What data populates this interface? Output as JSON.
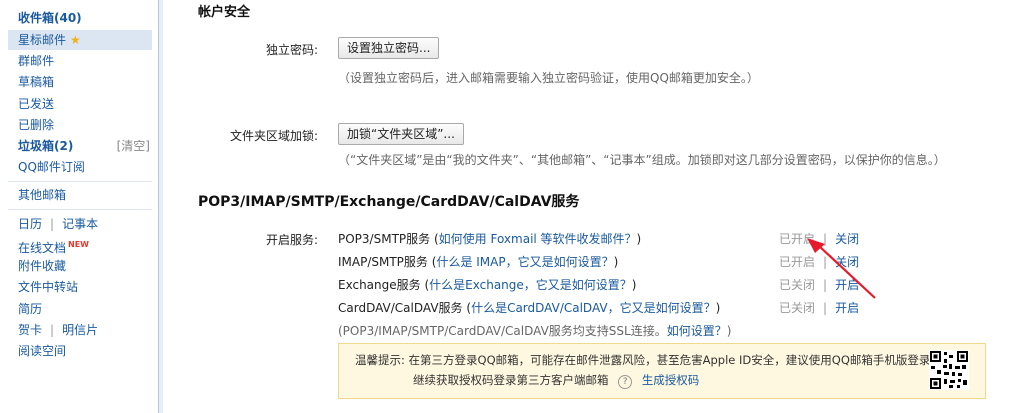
{
  "sidebar": {
    "inbox": "收件箱(40)",
    "starred": "星标邮件",
    "group": "群邮件",
    "drafts": "草稿箱",
    "sent": "已发送",
    "deleted": "已删除",
    "spam": "垃圾箱(2)",
    "spam_clear": "[清空]",
    "subscriptions": "QQ邮件订阅",
    "other_mailbox": "其他邮箱",
    "calendar": "日历",
    "notepad": "记事本",
    "online_docs": "在线文档",
    "new_badge": "NEW",
    "attachments": "附件收藏",
    "file_transfer": "文件中转站",
    "resume": "简历",
    "greeting_card": "贺卡",
    "postcard": "明信片",
    "reading_space": "阅读空间"
  },
  "account_security": {
    "title": "帐户安全",
    "independent_password": {
      "label": "独立密码:",
      "button": "设置独立密码...",
      "hint": "（设置独立密码后，进入邮箱需要输入独立密码验证，使用QQ邮箱更加安全。）"
    },
    "folder_lock": {
      "label": "文件夹区域加锁:",
      "button": "加锁“文件夹区域”...",
      "hint": "（“文件夹区域”是由“我的文件夹”、“其他邮箱”、“记事本”组成。加锁即对这几部分设置密码，以保护你的信息。）"
    }
  },
  "services": {
    "title": "POP3/IMAP/SMTP/Exchange/CardDAV/CalDAV服务",
    "label": "开启服务:",
    "rows": [
      {
        "name": "POP3/SMTP服务",
        "open_paren": "(",
        "help": "如何使用 Foxmail 等软件收发邮件？",
        "close_paren": ")",
        "status": "已开启",
        "action": "关闭"
      },
      {
        "name": "IMAP/SMTP服务",
        "open_paren": "(",
        "help": "什么是 IMAP，它又是如何设置？",
        "close_paren": ")",
        "status": "已开启",
        "action": "关闭"
      },
      {
        "name": "Exchange服务",
        "open_paren": "(",
        "help": "什么是Exchange，它又是如何设置？",
        "close_paren": ")",
        "status": "已关闭",
        "action": "开启"
      },
      {
        "name": "CardDAV/CalDAV服务",
        "open_paren": "(",
        "help": "什么是CardDAV/CalDAV，它又是如何设置？",
        "close_paren": ")",
        "status": "已关闭",
        "action": "开启"
      }
    ],
    "ssl_note": "(POP3/IMAP/SMTP/CardDAV/CalDAV服务均支持SSL连接。",
    "ssl_link": "如何设置？",
    "ssl_close": ")",
    "separator": "|"
  },
  "tip": {
    "line1": "温馨提示: 在第三方登录QQ邮箱，可能存在邮件泄露风险，甚至危害Apple ID安全，建议使用QQ邮箱手机版登录。",
    "line2": "继续获取授权码登录第三方客户端邮箱",
    "help_icon": "?",
    "link": "生成授权码"
  },
  "colors": {
    "link": "#1a5aa0",
    "annotation_arrow": "#e8192c",
    "tip_bg": "#fff8e0"
  }
}
